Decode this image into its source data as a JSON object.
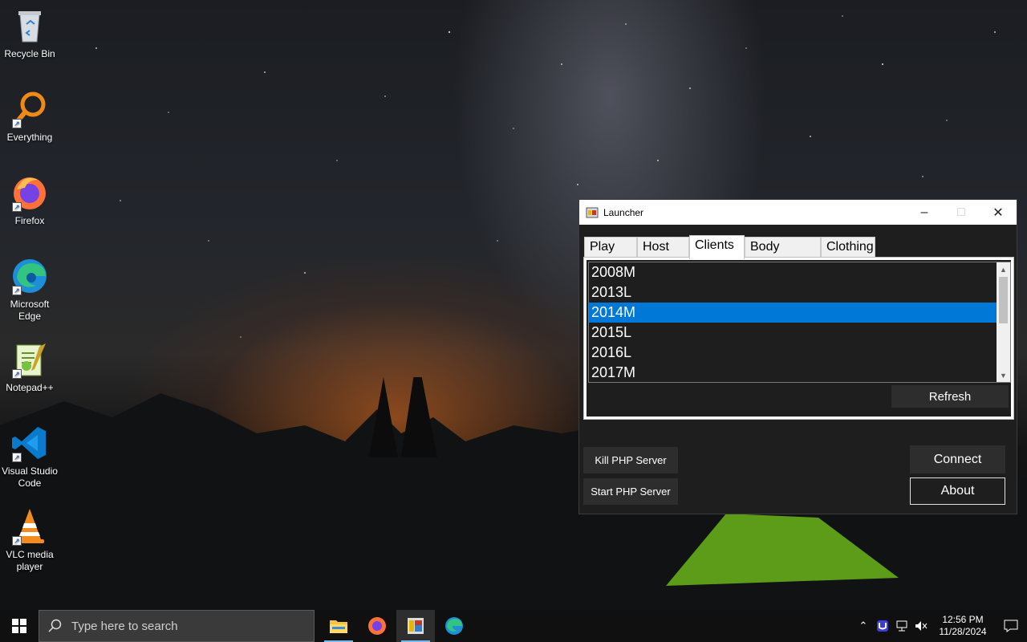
{
  "desktop": {
    "icons": [
      {
        "label": "Recycle Bin",
        "icon": "recycle-bin-icon"
      },
      {
        "label": "Everything",
        "icon": "everything-search-icon"
      },
      {
        "label": "Firefox",
        "icon": "firefox-icon"
      },
      {
        "label": "Microsoft Edge",
        "icon": "edge-icon"
      },
      {
        "label": "Notepad++",
        "icon": "notepadpp-icon"
      },
      {
        "label": "Visual Studio Code",
        "icon": "vscode-icon"
      },
      {
        "label": "VLC media player",
        "icon": "vlc-icon"
      }
    ]
  },
  "window": {
    "title": "Launcher",
    "tabs": [
      {
        "label": "Play"
      },
      {
        "label": "Host"
      },
      {
        "label": "Clients"
      },
      {
        "label": "Body Colors"
      },
      {
        "label": "Clothing"
      }
    ],
    "active_tab": "Clients",
    "clients": [
      "2008M",
      "2013L",
      "2014M",
      "2015L",
      "2016L",
      "2017M"
    ],
    "selected_client": "2014M",
    "refresh_label": "Refresh",
    "kill_server_label": "Kill PHP Server",
    "start_server_label": "Start PHP Server",
    "connect_label": "Connect",
    "about_label": "About"
  },
  "taskbar": {
    "search_placeholder": "Type here to search",
    "time": "12:56 PM",
    "date": "11/28/2024",
    "apps": [
      "file-explorer-icon",
      "firefox-icon",
      "launcher-icon",
      "edge-icon"
    ]
  },
  "colors": {
    "selection": "#0078d7",
    "window_bg": "#1e1e1e",
    "button_bg": "#2d2d2d"
  }
}
